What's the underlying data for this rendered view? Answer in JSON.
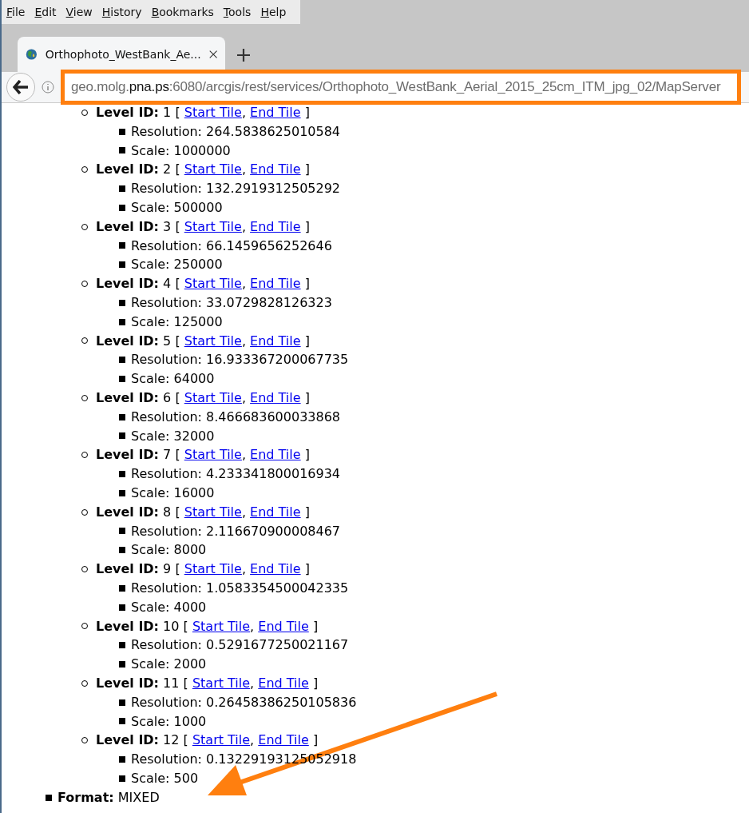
{
  "menu": [
    "File",
    "Edit",
    "View",
    "History",
    "Bookmarks",
    "Tools",
    "Help"
  ],
  "tab": {
    "title": "Orthophoto_WestBank_Ae...",
    "selected": true
  },
  "address": {
    "host_start": "geo.molg.",
    "host_domain": "pna.ps",
    "rest": ":6080/arcgis/rest/services/Orthophoto_WestBank_Aerial_2015_25cm_ITM_jpg_02/MapServer",
    "highlighted": true
  },
  "levels": [
    {
      "label": "Level ID:",
      "id": "1 [",
      "start": "Start Tile",
      "sep": ",",
      "end": "End Tile",
      "close": "]",
      "resolution": "Resolution: 264.5838625010584",
      "scale": "Scale: 1000000"
    },
    {
      "label": "Level ID:",
      "id": "2 [",
      "start": "Start Tile",
      "sep": ",",
      "end": "End Tile",
      "close": "]",
      "resolution": "Resolution: 132.2919312505292",
      "scale": "Scale: 500000"
    },
    {
      "label": "Level ID:",
      "id": "3 [",
      "start": "Start Tile",
      "sep": ",",
      "end": "End Tile",
      "close": "]",
      "resolution": "Resolution: 66.1459656252646",
      "scale": "Scale: 250000"
    },
    {
      "label": "Level ID:",
      "id": "4 [",
      "start": "Start Tile",
      "sep": ",",
      "end": "End Tile",
      "close": "]",
      "resolution": "Resolution: 33.0729828126323",
      "scale": "Scale: 125000"
    },
    {
      "label": "Level ID:",
      "id": "5 [",
      "start": "Start Tile",
      "sep": ",",
      "end": "End Tile",
      "close": "]",
      "resolution": "Resolution: 16.933367200067735",
      "scale": "Scale: 64000"
    },
    {
      "label": "Level ID:",
      "id": "6 [",
      "start": "Start Tile",
      "sep": ",",
      "end": "End Tile",
      "close": "]",
      "resolution": "Resolution: 8.466683600033868",
      "scale": "Scale: 32000"
    },
    {
      "label": "Level ID:",
      "id": "7 [",
      "start": "Start Tile",
      "sep": ",",
      "end": "End Tile",
      "close": "]",
      "resolution": "Resolution: 4.233341800016934",
      "scale": "Scale: 16000"
    },
    {
      "label": "Level ID:",
      "id": "8 [",
      "start": "Start Tile",
      "sep": ",",
      "end": "End Tile",
      "close": "]",
      "resolution": "Resolution: 2.116670900008467",
      "scale": "Scale: 8000"
    },
    {
      "label": "Level ID:",
      "id": "9 [",
      "start": "Start Tile",
      "sep": ",",
      "end": "End Tile",
      "close": "]",
      "resolution": "Resolution: 1.0583354500042335",
      "scale": "Scale: 4000"
    },
    {
      "label": "Level ID:",
      "id": "10 [",
      "start": "Start Tile",
      "sep": ",",
      "end": "End Tile",
      "close": "]",
      "resolution": "Resolution: 0.5291677250021167",
      "scale": "Scale: 2000"
    },
    {
      "label": "Level ID:",
      "id": "11 [",
      "start": "Start Tile",
      "sep": ",",
      "end": "End Tile",
      "close": "]",
      "resolution": "Resolution: 0.26458386250105836",
      "scale": "Scale: 1000"
    },
    {
      "label": "Level ID:",
      "id": "12 [",
      "start": "Start Tile",
      "sep": ",",
      "end": "End Tile",
      "close": "]",
      "resolution": "Resolution: 0.13229193125052918",
      "scale": "Scale: 500"
    }
  ],
  "format": {
    "label": "Format:",
    "value": "MIXED"
  },
  "pointer_arrow": true
}
